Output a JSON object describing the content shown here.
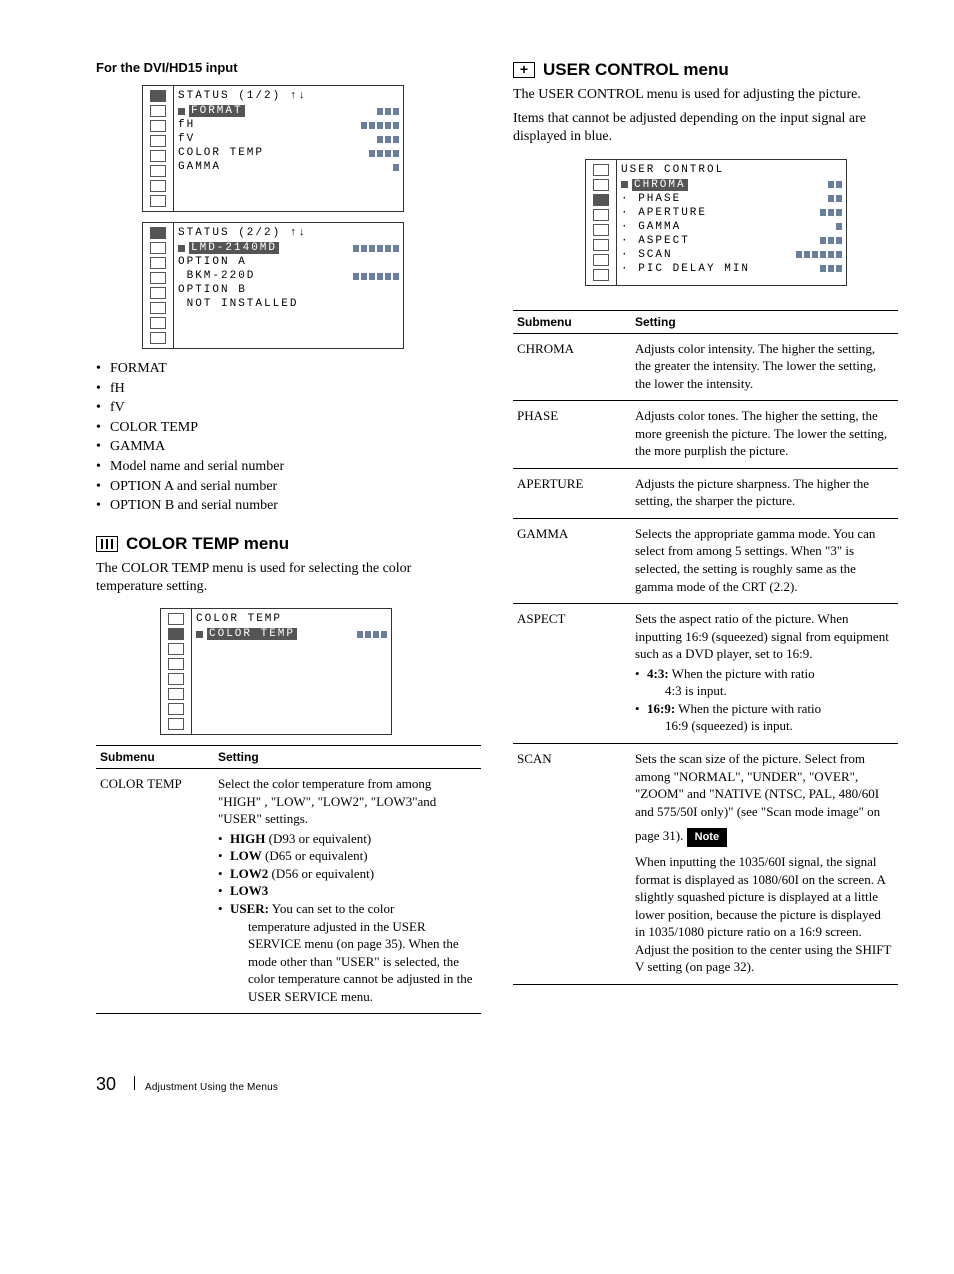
{
  "left": {
    "heading": "For the DVI/HD15 input",
    "osd1": {
      "title": "STATUS (1/2) ↑↓",
      "rows": [
        {
          "label": "FORMAT",
          "ticks": 3,
          "sel": true,
          "square": true
        },
        {
          "label": "fH",
          "ticks": 5
        },
        {
          "label": "fV",
          "ticks": 3
        },
        {
          "label": "COLOR TEMP",
          "ticks": 4
        },
        {
          "label": "GAMMA",
          "ticks": 1
        }
      ]
    },
    "osd2": {
      "title": "STATUS (2/2) ↑↓",
      "rows": [
        {
          "label": "LMD-2140MD",
          "ticks": 6,
          "sel": true,
          "square": true
        },
        {
          "label": "OPTION A",
          "ticks": 0
        },
        {
          "label": " BKM-220D",
          "ticks": 6
        },
        {
          "label": "OPTION B",
          "ticks": 0
        },
        {
          "label": " NOT INSTALLED",
          "ticks": 0
        }
      ]
    },
    "bullets": [
      "FORMAT",
      "fH",
      "fV",
      "COLOR TEMP",
      "GAMMA",
      "Model name and serial number",
      "OPTION A and serial number",
      "OPTION B and serial number"
    ],
    "color_temp_heading": "COLOR TEMP menu",
    "color_temp_intro": "The COLOR TEMP menu is used for selecting the color temperature setting.",
    "osd3": {
      "title": "COLOR TEMP",
      "rows": [
        {
          "label": "COLOR TEMP",
          "ticks": 4,
          "sel": true,
          "square": true
        }
      ]
    },
    "table": {
      "headers": [
        "Submenu",
        "Setting"
      ],
      "rows": [
        {
          "submenu": "COLOR TEMP",
          "setting_lead": "Select the color temperature from among \"HIGH\" , \"LOW\", \"LOW2\", \"LOW3\"and \"USER\" settings.",
          "items": [
            {
              "b": "HIGH",
              "t": " (D93 or equivalent)"
            },
            {
              "b": "LOW",
              "t": " (D65 or equivalent)"
            },
            {
              "b": "LOW2",
              "t": " (D56 or equivalent)"
            },
            {
              "b": "LOW3",
              "t": ""
            },
            {
              "b": "USER:",
              "t": " You can set to the color",
              "tail": "temperature adjusted in the USER SERVICE menu (on page 35).  When the mode other than \"USER\" is selected, the color temperature cannot be adjusted in the USER SERVICE menu."
            }
          ]
        }
      ]
    }
  },
  "right": {
    "heading": "USER CONTROL menu",
    "intro1": "The USER CONTROL menu is used for adjusting the picture.",
    "intro2": "Items that cannot be adjusted depending on the input signal are displayed in blue.",
    "osd": {
      "title": "USER CONTROL",
      "rows": [
        {
          "label": "CHROMA",
          "ticks": 2,
          "sel": true,
          "square": true
        },
        {
          "label": "· PHASE",
          "ticks": 2
        },
        {
          "label": "· APERTURE",
          "ticks": 3
        },
        {
          "label": "· GAMMA",
          "ticks": 1
        },
        {
          "label": "· ASPECT",
          "ticks": 3
        },
        {
          "label": "· SCAN",
          "ticks": 6
        },
        {
          "label": "· PIC DELAY MIN",
          "ticks": 3
        }
      ]
    },
    "table": {
      "headers": [
        "Submenu",
        "Setting"
      ],
      "rows": [
        {
          "submenu": "CHROMA",
          "setting": "Adjusts color intensity.  The higher the setting, the greater the intensity. The lower the setting, the lower the intensity."
        },
        {
          "submenu": "PHASE",
          "setting": "Adjusts color tones.  The higher the setting, the more greenish the picture.  The lower the setting, the more purplish the picture."
        },
        {
          "submenu": "APERTURE",
          "setting": "Adjusts the picture sharpness. The higher the setting, the sharper the picture."
        },
        {
          "submenu": "GAMMA",
          "setting": "Selects the appropriate gamma mode.  You can select from among 5 settings.  When \"3\" is selected, the setting is roughly same as the gamma mode of the CRT (2.2)."
        },
        {
          "submenu": "ASPECT",
          "setting": "Sets the aspect ratio of the picture. When inputting 16:9 (squeezed) signal from equipment such as a DVD player, set to 16:9.",
          "items": [
            {
              "b": "4:3:",
              "t": " When the picture with ratio",
              "tail": "4:3 is input."
            },
            {
              "b": "16:9:",
              "t": " When the picture with ratio",
              "tail": "16:9 (squeezed) is input."
            }
          ]
        },
        {
          "submenu": "SCAN",
          "setting": "Sets the scan size of the picture. Select from among \"NORMAL\", \"UNDER\", \"OVER\", \"ZOOM\" and \"NATIVE (NTSC, PAL, 480/60I and 575/50I only)\" (see \"Scan mode image\" on page 31).",
          "note_label": "Note",
          "note": "When inputting the 1035/60I signal, the signal format is displayed as 1080/60I on the screen.  A slightly squashed picture is displayed at a little lower position, because the picture is displayed in 1035/1080 picture ratio on a 16:9 screen.  Adjust the position to the center using the SHIFT V setting (on page 32)."
        }
      ]
    }
  },
  "footer": {
    "page": "30",
    "caption": "Adjustment Using the Menus"
  }
}
